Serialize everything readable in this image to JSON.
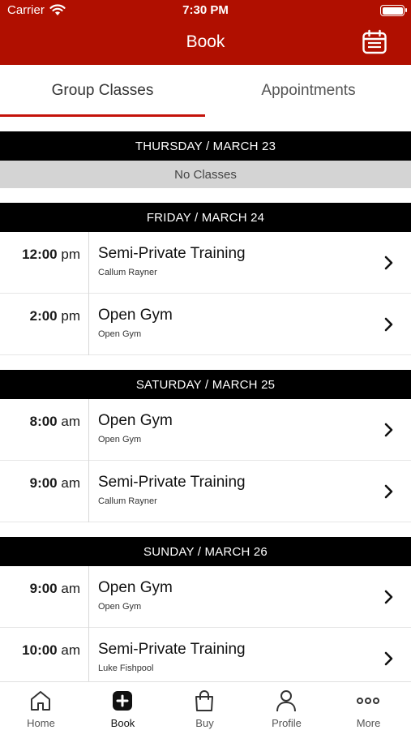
{
  "status_bar": {
    "carrier": "Carrier",
    "time": "7:30 PM"
  },
  "header": {
    "title": "Book",
    "calendar_icon": "calendar-icon",
    "background": "#b00f00"
  },
  "tabs": [
    {
      "label": "Group Classes",
      "active": true
    },
    {
      "label": "Appointments",
      "active": false
    }
  ],
  "accent_color": "#c4120a",
  "days": [
    {
      "label": "THURSDAY / MARCH 23",
      "empty_text": "No Classes"
    },
    {
      "label": "FRIDAY / MARCH 24",
      "classes": [
        {
          "time": "12:00",
          "meridiem": "pm",
          "name": "Semi-Private Training",
          "instructor": "Callum Rayner"
        },
        {
          "time": "2:00",
          "meridiem": "pm",
          "name": "Open Gym",
          "instructor": "Open Gym"
        }
      ]
    },
    {
      "label": "SATURDAY / MARCH 25",
      "classes": [
        {
          "time": "8:00",
          "meridiem": "am",
          "name": "Open Gym",
          "instructor": "Open Gym"
        },
        {
          "time": "9:00",
          "meridiem": "am",
          "name": "Semi-Private Training",
          "instructor": "Callum Rayner"
        }
      ]
    },
    {
      "label": "SUNDAY / MARCH 26",
      "classes": [
        {
          "time": "9:00",
          "meridiem": "am",
          "name": "Open Gym",
          "instructor": "Open Gym"
        },
        {
          "time": "10:00",
          "meridiem": "am",
          "name": "Semi-Private Training",
          "instructor": "Luke Fishpool"
        }
      ]
    }
  ],
  "tab_bar": [
    {
      "label": "Home",
      "icon": "home-icon",
      "active": false
    },
    {
      "label": "Book",
      "icon": "plus-square-icon",
      "active": true
    },
    {
      "label": "Buy",
      "icon": "shopping-bag-icon",
      "active": false
    },
    {
      "label": "Profile",
      "icon": "person-icon",
      "active": false
    },
    {
      "label": "More",
      "icon": "more-dots-icon",
      "active": false
    }
  ]
}
